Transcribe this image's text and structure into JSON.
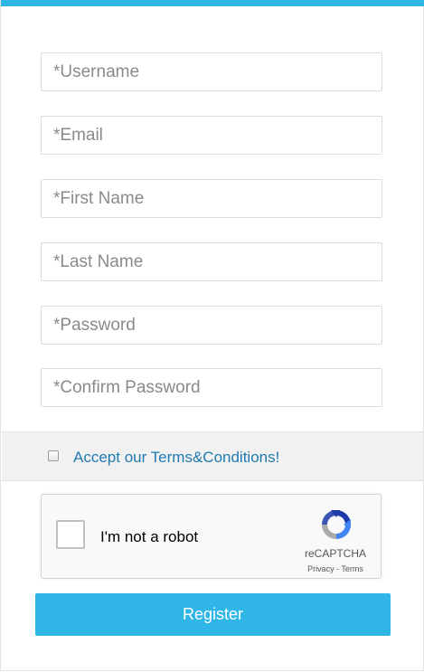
{
  "form": {
    "fields": [
      {
        "placeholder": "*Username",
        "value": ""
      },
      {
        "placeholder": "*Email",
        "value": ""
      },
      {
        "placeholder": "*First Name",
        "value": ""
      },
      {
        "placeholder": "*Last Name",
        "value": ""
      },
      {
        "placeholder": "*Password",
        "value": ""
      },
      {
        "placeholder": "*Confirm Password",
        "value": ""
      }
    ],
    "terms_label": "Accept our Terms&Conditions!",
    "terms_checked": false,
    "register_label": "Register"
  },
  "recaptcha": {
    "label": "I'm not a robot",
    "brand": "reCAPTCHA",
    "privacy": "Privacy",
    "separator": " - ",
    "terms": "Terms",
    "checked": false
  },
  "colors": {
    "accent": "#2fb6e6",
    "link": "#1f7ab0",
    "band": "#f1f1f1"
  }
}
